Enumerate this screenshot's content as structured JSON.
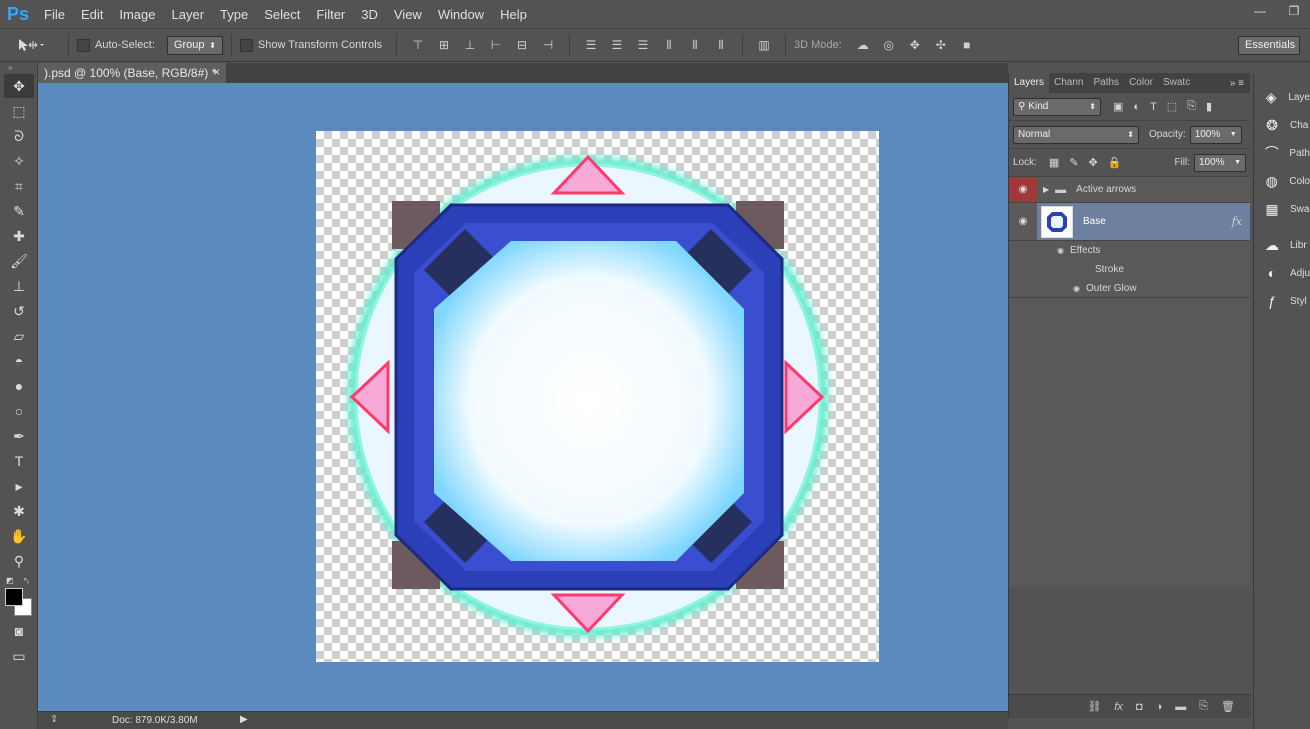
{
  "app": {
    "logo": "Ps"
  },
  "menu": [
    "File",
    "Edit",
    "Image",
    "Layer",
    "Type",
    "Select",
    "Filter",
    "3D",
    "View",
    "Window",
    "Help"
  ],
  "window_controls": {
    "minimize": "—",
    "restore": "❐"
  },
  "options": {
    "auto_select_label": "Auto-Select:",
    "auto_select_value": "Group",
    "show_transform_label": "Show Transform Controls",
    "mode_3d_label": "3D Mode:",
    "workspace": "Essentials"
  },
  "document_tab": {
    "title": ").psd @ 100% (Base, RGB/8#) *",
    "close": "×"
  },
  "status": {
    "doc_info": "Doc: 879.0K/3.80M"
  },
  "layers_panel": {
    "tabs": [
      "Layers",
      "Chann",
      "Paths",
      "Color",
      "Swatc"
    ],
    "filter_label": "Kind",
    "blend_mode": "Normal",
    "opacity_label": "Opacity:",
    "opacity_value": "100%",
    "lock_label": "Lock:",
    "fill_label": "Fill:",
    "fill_value": "100%",
    "layers": [
      {
        "name": "Active arrows",
        "type": "group",
        "visible": true
      },
      {
        "name": "Base",
        "type": "layer",
        "visible": true,
        "selected": true,
        "fx": "fx"
      }
    ],
    "effects_label": "Effects",
    "effects": [
      "Stroke",
      "Outer Glow"
    ]
  },
  "dock": [
    {
      "label": "Laye",
      "icon": "layers-icon"
    },
    {
      "label": "Cha",
      "icon": "channels-icon"
    },
    {
      "label": "Path",
      "icon": "paths-icon"
    },
    {
      "label": "Colo",
      "icon": "color-icon"
    },
    {
      "label": "Swa",
      "icon": "swatches-icon"
    },
    {
      "label": "Libr",
      "icon": "libraries-icon"
    },
    {
      "label": "Adju",
      "icon": "adjustments-icon"
    },
    {
      "label": "Styl",
      "icon": "styles-icon"
    }
  ],
  "colors": {
    "canvas_bg": "#5b8abf",
    "arrow_fill": "#f5a8d8",
    "arrow_glow": "#ff4d7a",
    "ring_glow": "#50e6c8",
    "frame_blue": "#2b3fb8",
    "core_white": "#ffffff"
  }
}
